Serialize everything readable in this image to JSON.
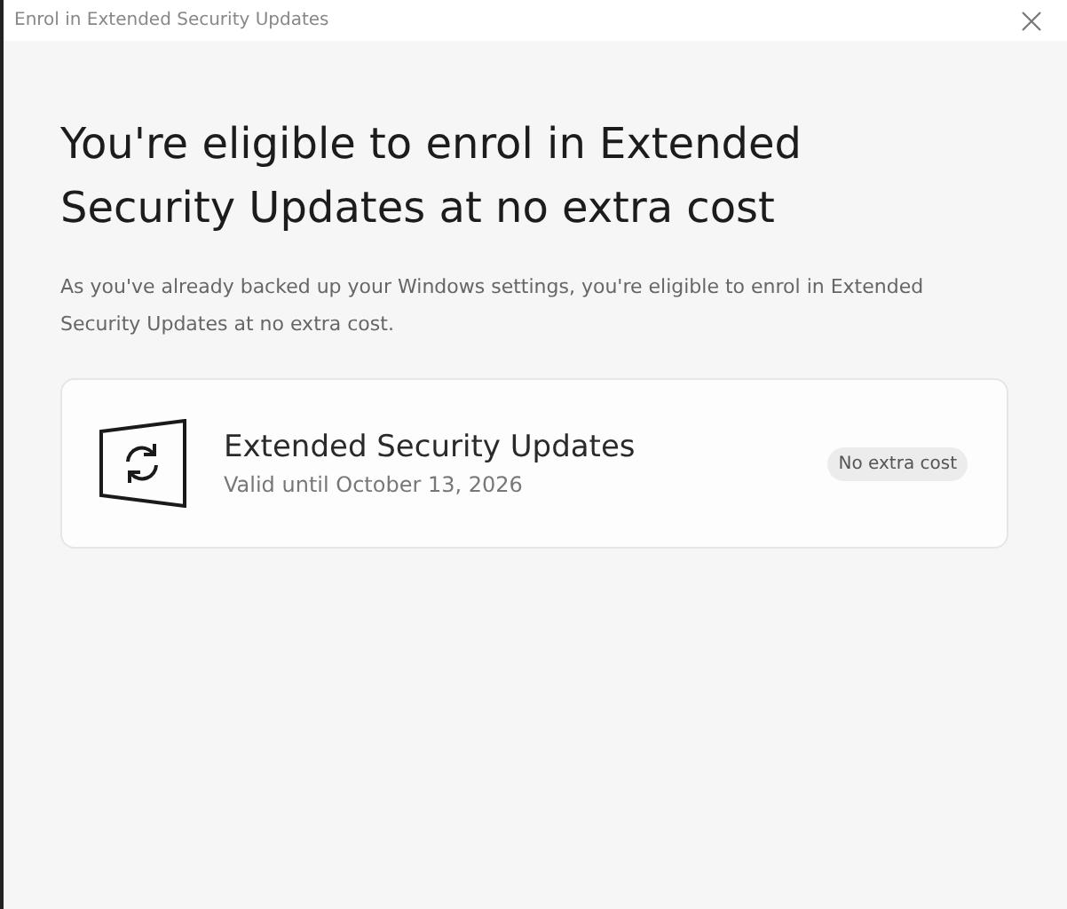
{
  "window": {
    "title": "Enrol in Extended Security Updates"
  },
  "heading": "You're eligible to enrol in Extended Security Updates at no extra cost",
  "description": "As you've already backed up your Windows settings, you're eligible to enrol in Extended Security Updates at no extra cost.",
  "card": {
    "title": "Extended Security Updates",
    "subtitle": "Valid until October 13, 2026",
    "badge": "No extra cost"
  }
}
